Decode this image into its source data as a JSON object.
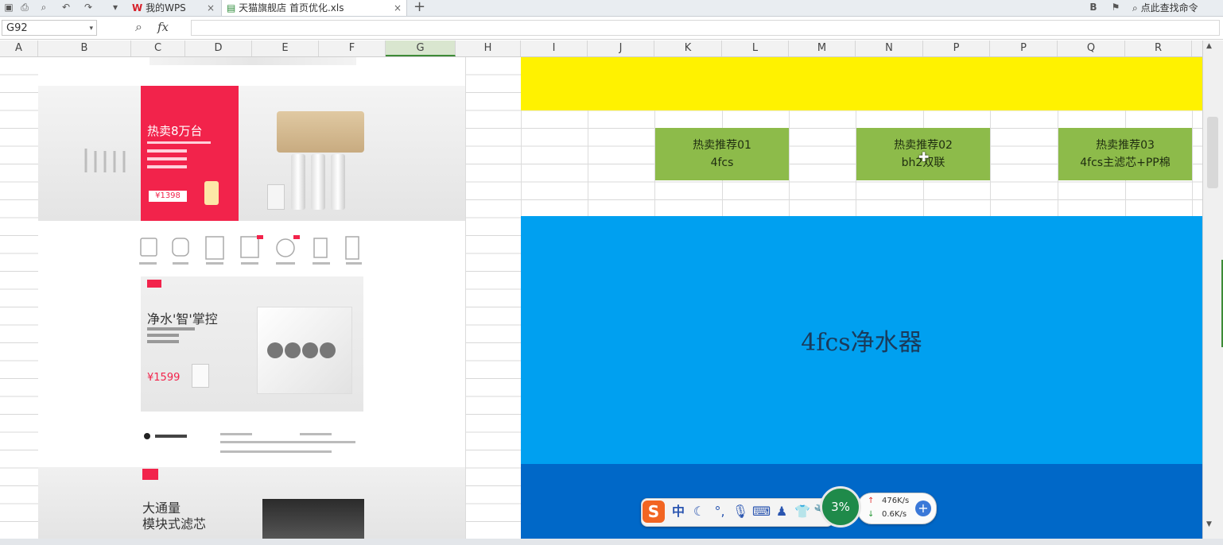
{
  "titlebar": {
    "tabs": [
      {
        "label": "我的WPS",
        "close": "×"
      },
      {
        "label": "天猫旗舰店 首页优化.xls",
        "close": "×"
      }
    ],
    "new_tab": "+",
    "search_label": "点此查找命令"
  },
  "formula_bar": {
    "cell_ref": "G92",
    "fx": "fx",
    "value": ""
  },
  "columns": [
    "A",
    "B",
    "C",
    "D",
    "E",
    "F",
    "G",
    "H",
    "I",
    "J",
    "K",
    "L",
    "M",
    "N",
    "P",
    "P",
    "Q",
    "R"
  ],
  "selected_column": "G",
  "image": {
    "banner1": {
      "title": "热卖8万台",
      "price": "¥1398"
    },
    "banner2": {
      "title": "净水'智'掌控",
      "price": "¥1599"
    },
    "banner3": {
      "title_line1": "大通量",
      "title_line2": "模块式滤芯"
    }
  },
  "cells": {
    "hot1": {
      "line1": "热卖推荐01",
      "line2": "4fcs"
    },
    "hot2": {
      "line1": "热卖推荐02",
      "line2": "bh2双联"
    },
    "hot3": {
      "line1": "热卖推荐03",
      "line2": "4fcs主滤芯+PP棉"
    },
    "main_label": "4fcs净水器"
  },
  "colors": {
    "yellow": "#fff200",
    "blue": "#00a0f0",
    "dark_blue": "#0068c8",
    "green": "#8dbb4a",
    "red_banner": "#f2234b"
  },
  "ime_toolbar": {
    "logo": "S",
    "mode": "中"
  },
  "net_monitor": {
    "percent": "3%",
    "up": "476K/s",
    "down": "0.6K/s"
  }
}
